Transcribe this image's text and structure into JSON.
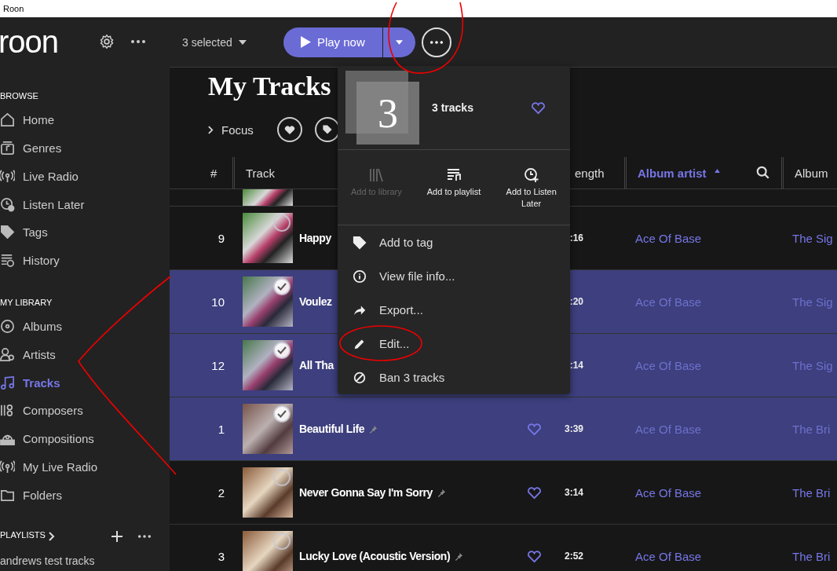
{
  "window": {
    "title": "Roon"
  },
  "app": {
    "logo": "roon"
  },
  "toolbar": {
    "selection": "3 selected",
    "play_button": "Play now"
  },
  "sidebar": {
    "sections": [
      {
        "heading": "BROWSE",
        "items": [
          {
            "label": "Home",
            "kind": "home",
            "selected": false
          },
          {
            "label": "Genres",
            "kind": "genres",
            "selected": false
          },
          {
            "label": "Live Radio",
            "kind": "radio",
            "selected": false
          },
          {
            "label": "Listen Later",
            "kind": "clock",
            "selected": false
          },
          {
            "label": "Tags",
            "kind": "tag",
            "selected": false
          },
          {
            "label": "History",
            "kind": "history",
            "selected": false
          }
        ]
      },
      {
        "heading": "MY LIBRARY",
        "items": [
          {
            "label": "Albums",
            "kind": "album",
            "selected": false
          },
          {
            "label": "Artists",
            "kind": "artist",
            "selected": false
          },
          {
            "label": "Tracks",
            "kind": "note",
            "selected": true
          },
          {
            "label": "Composers",
            "kind": "composers",
            "selected": false
          },
          {
            "label": "Compositions",
            "kind": "compositions",
            "selected": false
          },
          {
            "label": "My Live Radio",
            "kind": "radio",
            "selected": false
          },
          {
            "label": "Folders",
            "kind": "folder",
            "selected": false
          }
        ]
      }
    ],
    "playlists": {
      "heading": "PLAYLISTS",
      "items": [
        "andrews test tracks"
      ]
    }
  },
  "page": {
    "title": "My Tracks",
    "focus": "Focus"
  },
  "table": {
    "columns": [
      {
        "label": "#",
        "sorted": false
      },
      {
        "label": "Track",
        "sorted": false
      },
      {
        "label": "ength",
        "sorted": false
      },
      {
        "label": "Album artist",
        "sorted": true
      },
      {
        "label": "Album",
        "sorted": false
      }
    ],
    "rows": [
      {
        "number": "9",
        "title": "Happy",
        "pinned": false,
        "length": ":16",
        "artist": "Ace Of Base",
        "album": "The Sig",
        "selected": false
      },
      {
        "number": "10",
        "title": "Voulez",
        "pinned": false,
        "length": ":20",
        "artist": "Ace Of Base",
        "album": "The Sig",
        "selected": true
      },
      {
        "number": "12",
        "title": "All Tha",
        "pinned": false,
        "length": ":14",
        "artist": "Ace Of Base",
        "album": "The Sig",
        "selected": true
      },
      {
        "number": "1",
        "title": "Beautiful Life",
        "pinned": true,
        "length": "3:39",
        "artist": "Ace Of Base",
        "album": "The Bri",
        "selected": true
      },
      {
        "number": "2",
        "title": "Never Gonna Say I'm Sorry",
        "pinned": true,
        "length": "3:14",
        "artist": "Ace Of Base",
        "album": "The Bri",
        "selected": false
      },
      {
        "number": "3",
        "title": "Lucky Love (Acoustic Version)",
        "pinned": true,
        "length": "2:52",
        "artist": "Ace Of Base",
        "album": "The Bri",
        "selected": false
      }
    ]
  },
  "menu": {
    "count": "3",
    "title": "3 tracks",
    "actions": [
      {
        "label": "Add to library",
        "kind": "library",
        "disabled": true
      },
      {
        "label": "Add to playlist",
        "kind": "playlist",
        "disabled": false
      },
      {
        "label": "Add to Listen Later",
        "kind": "later",
        "disabled": false
      }
    ],
    "items": [
      {
        "label": "Add to tag",
        "kind": "tag"
      },
      {
        "label": "View file info...",
        "kind": "info"
      },
      {
        "label": "Export...",
        "kind": "export"
      },
      {
        "label": "Edit...",
        "kind": "edit"
      },
      {
        "label": "Ban 3 tracks",
        "kind": "ban"
      }
    ]
  }
}
